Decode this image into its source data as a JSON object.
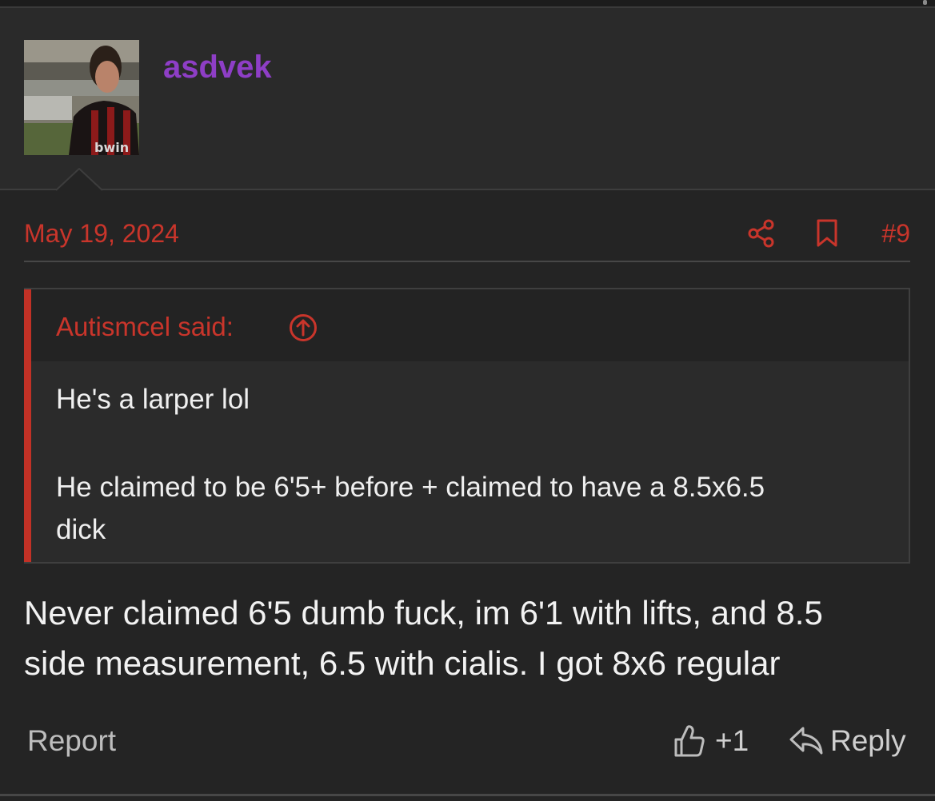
{
  "post": {
    "username": "asdvek",
    "avatar_alt": "user avatar",
    "date": "May 19, 2024",
    "post_number": "#9",
    "quote": {
      "author_label": "Autismcel said:",
      "lines": [
        "He's a larper lol",
        "He claimed to be 6'5+ before + claimed to have a 8.5x6.5",
        "dick"
      ]
    },
    "message_lines": [
      "Never claimed 6'5 dumb fuck, im 6'1 with lifts, and 8.5",
      "side measurement, 6.5 with cialis. I got 8x6 regular"
    ],
    "actions": {
      "report": "Report",
      "reaction_count": "+1",
      "reply": "Reply"
    }
  },
  "colors": {
    "background": "#242424",
    "header_background": "#2a2a2a",
    "accent_red": "#c9352b",
    "username_purple": "#8e3ec6",
    "quote_bar": "#c23126"
  }
}
